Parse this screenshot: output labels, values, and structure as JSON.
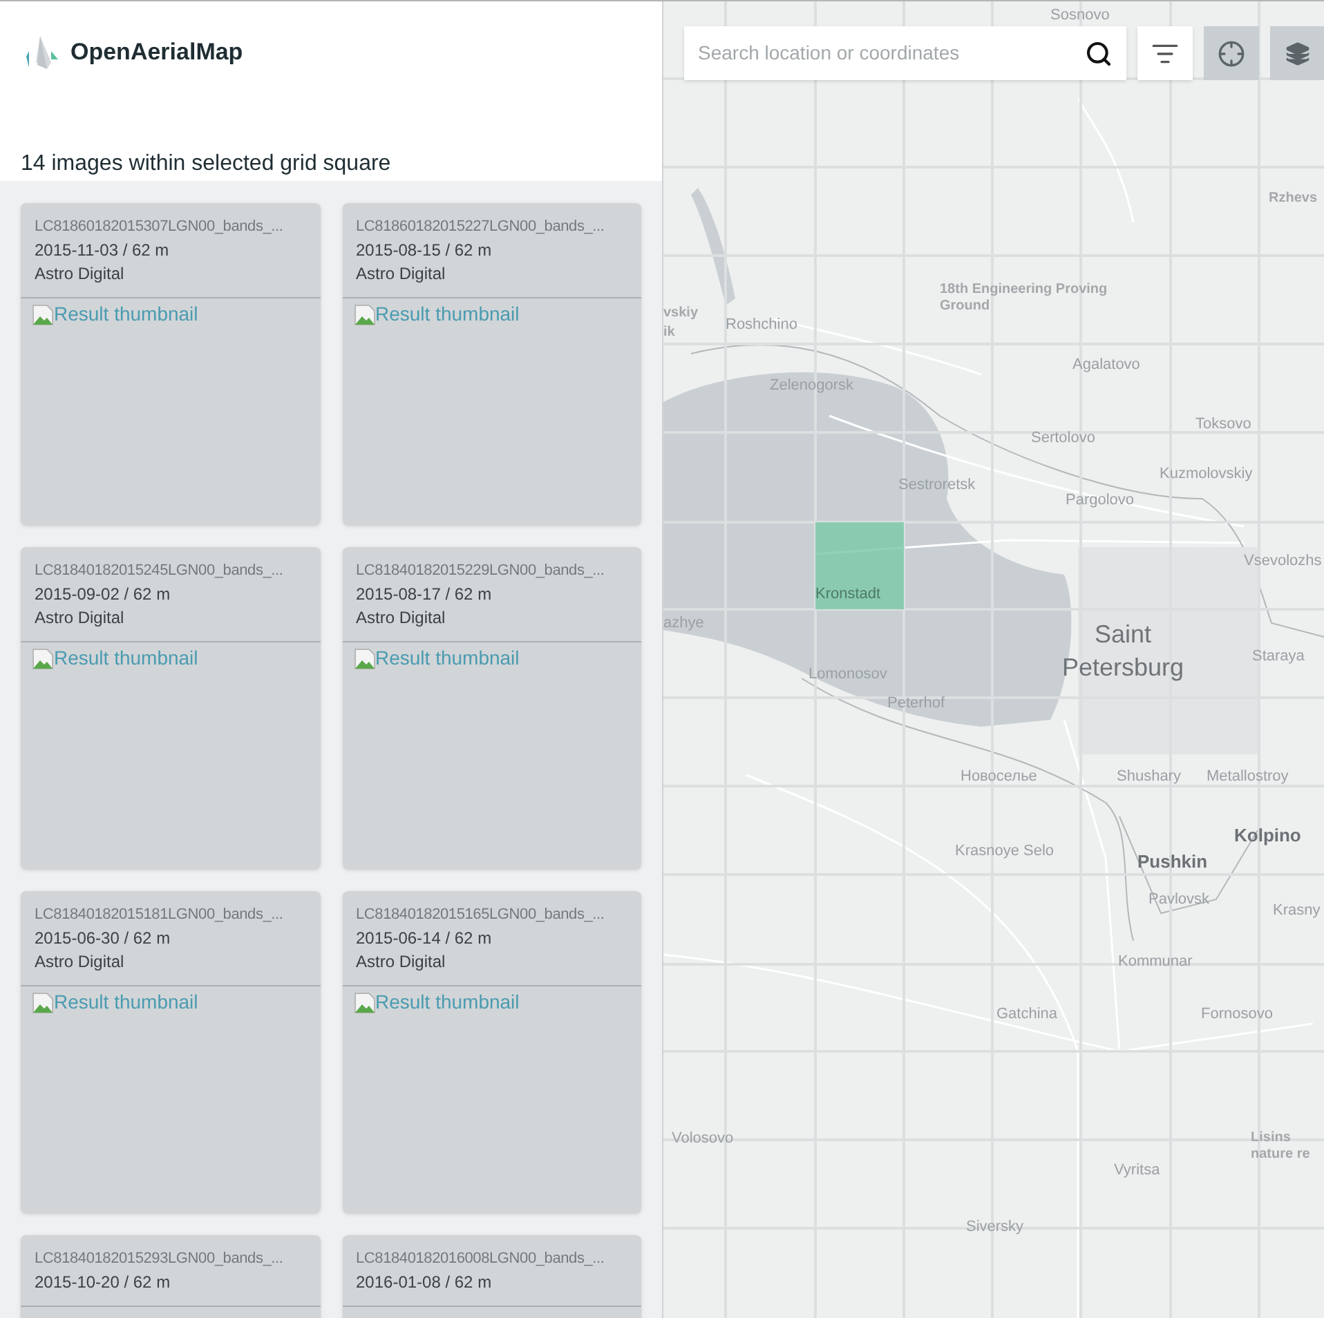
{
  "header": {
    "logo_text": "OpenAerialMap"
  },
  "results": {
    "heading": "14 images within selected grid square",
    "items": [
      {
        "title": "LC81860182015307LGN00_bands_...",
        "date": "2015-11-03 / 62 m",
        "provider": "Astro Digital",
        "thumbnail_alt": "Result thumbnail"
      },
      {
        "title": "LC81860182015227LGN00_bands_...",
        "date": "2015-08-15 / 62 m",
        "provider": "Astro Digital",
        "thumbnail_alt": "Result thumbnail"
      },
      {
        "title": "LC81840182015245LGN00_bands_...",
        "date": "2015-09-02 / 62 m",
        "provider": "Astro Digital",
        "thumbnail_alt": "Result thumbnail"
      },
      {
        "title": "LC81840182015229LGN00_bands_...",
        "date": "2015-08-17 / 62 m",
        "provider": "Astro Digital",
        "thumbnail_alt": "Result thumbnail"
      },
      {
        "title": "LC81840182015181LGN00_bands_...",
        "date": "2015-06-30 / 62 m",
        "provider": "Astro Digital",
        "thumbnail_alt": "Result thumbnail"
      },
      {
        "title": "LC81840182015165LGN00_bands_...",
        "date": "2015-06-14 / 62 m",
        "provider": "Astro Digital",
        "thumbnail_alt": "Result thumbnail"
      },
      {
        "title": "LC81840182015293LGN00_bands_...",
        "date": "2015-10-20 / 62 m"
      },
      {
        "title": "LC81840182016008LGN00_bands_...",
        "date": "2016-01-08 / 62 m"
      }
    ]
  },
  "map": {
    "search": {
      "placeholder": "Search location or coordinates"
    },
    "labels": [
      {
        "text": "Sosnovo",
        "kind": "town"
      },
      {
        "text": "Rzhevs",
        "kind": "area"
      },
      {
        "text": "vskiy",
        "kind": "area"
      },
      {
        "text": "ik",
        "kind": "area"
      },
      {
        "text": "Roshchino",
        "kind": "town"
      },
      {
        "text": "18th Engineering Proving Ground",
        "kind": "area"
      },
      {
        "text": "Zelenogorsk",
        "kind": "town"
      },
      {
        "text": "Agalatovo",
        "kind": "town"
      },
      {
        "text": "Toksovo",
        "kind": "town"
      },
      {
        "text": "Sertolovo",
        "kind": "town"
      },
      {
        "text": "Sestroretsk",
        "kind": "town"
      },
      {
        "text": "Kuzmolovskiy",
        "kind": "town"
      },
      {
        "text": "Pargolovo",
        "kind": "town"
      },
      {
        "text": "Vsevolozhs",
        "kind": "town"
      },
      {
        "text": "Kronstadt",
        "kind": "highlighted"
      },
      {
        "text": "azhye",
        "kind": "town"
      },
      {
        "text": "Saint Petersburg",
        "kind": "capital"
      },
      {
        "text": "Staraya",
        "kind": "town"
      },
      {
        "text": "Lomonosov",
        "kind": "town"
      },
      {
        "text": "Peterhof",
        "kind": "town"
      },
      {
        "text": "Новоселье",
        "kind": "town"
      },
      {
        "text": "Shushary",
        "kind": "town"
      },
      {
        "text": "Metallostroy",
        "kind": "town"
      },
      {
        "text": "Krasnoye Selo",
        "kind": "town"
      },
      {
        "text": "Kolpino",
        "kind": "city"
      },
      {
        "text": "Pushkin",
        "kind": "city"
      },
      {
        "text": "Pavlovsk",
        "kind": "town"
      },
      {
        "text": "Krasny",
        "kind": "town"
      },
      {
        "text": "Kommunar",
        "kind": "town"
      },
      {
        "text": "Gatchina",
        "kind": "town"
      },
      {
        "text": "Fornosovo",
        "kind": "town"
      },
      {
        "text": "Volosovo",
        "kind": "town"
      },
      {
        "text": "Lisins nature re",
        "kind": "area"
      },
      {
        "text": "Vyritsa",
        "kind": "town"
      },
      {
        "text": "Siversky",
        "kind": "town"
      }
    ]
  }
}
